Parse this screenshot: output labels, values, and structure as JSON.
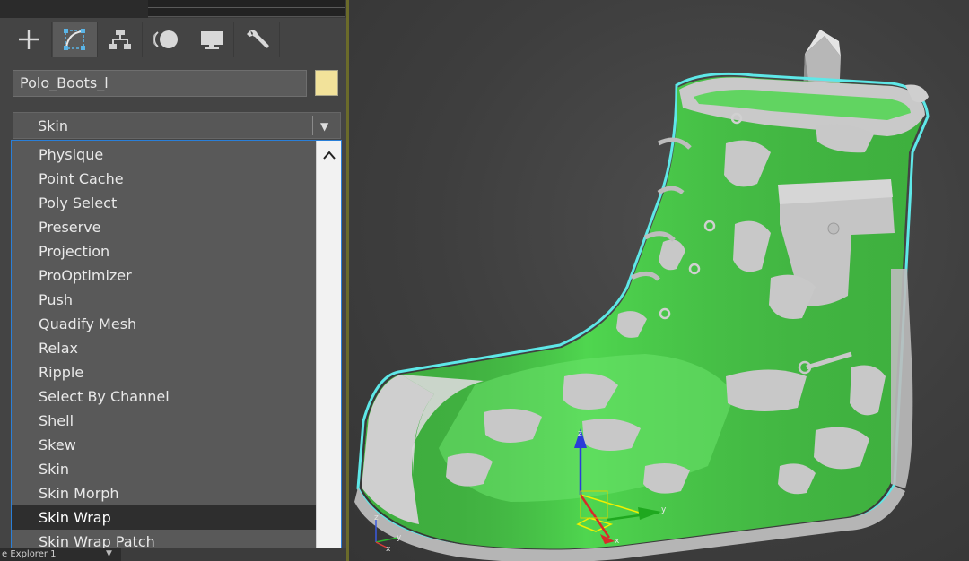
{
  "command_panel": {
    "tabs": [
      {
        "icon": "create-plus-icon"
      },
      {
        "icon": "modify-curve-icon",
        "active": true
      },
      {
        "icon": "hierarchy-icon"
      },
      {
        "icon": "motion-icon"
      },
      {
        "icon": "display-monitor-icon"
      },
      {
        "icon": "utilities-wrench-icon"
      }
    ],
    "object_name": "Polo_Boots_l",
    "object_color": "#f2e29a",
    "modifier_list": {
      "current": "Skin",
      "items": [
        "Physique",
        "Point Cache",
        "Poly Select",
        "Preserve",
        "Projection",
        "ProOptimizer",
        "Push",
        "Quadify Mesh",
        "Relax",
        "Ripple",
        "Select By Channel",
        "Shell",
        "Skew",
        "Skin",
        "Skin Morph",
        "Skin Wrap",
        "Skin Wrap Patch"
      ],
      "selected": "Skin Wrap"
    },
    "bottom_label": "e Explorer 1"
  },
  "viewport": {
    "axis_labels": {
      "x": "x",
      "y": "y",
      "z": "z"
    },
    "mesh_color": "#4fd64f",
    "outline_color": "#5ee8e8"
  }
}
